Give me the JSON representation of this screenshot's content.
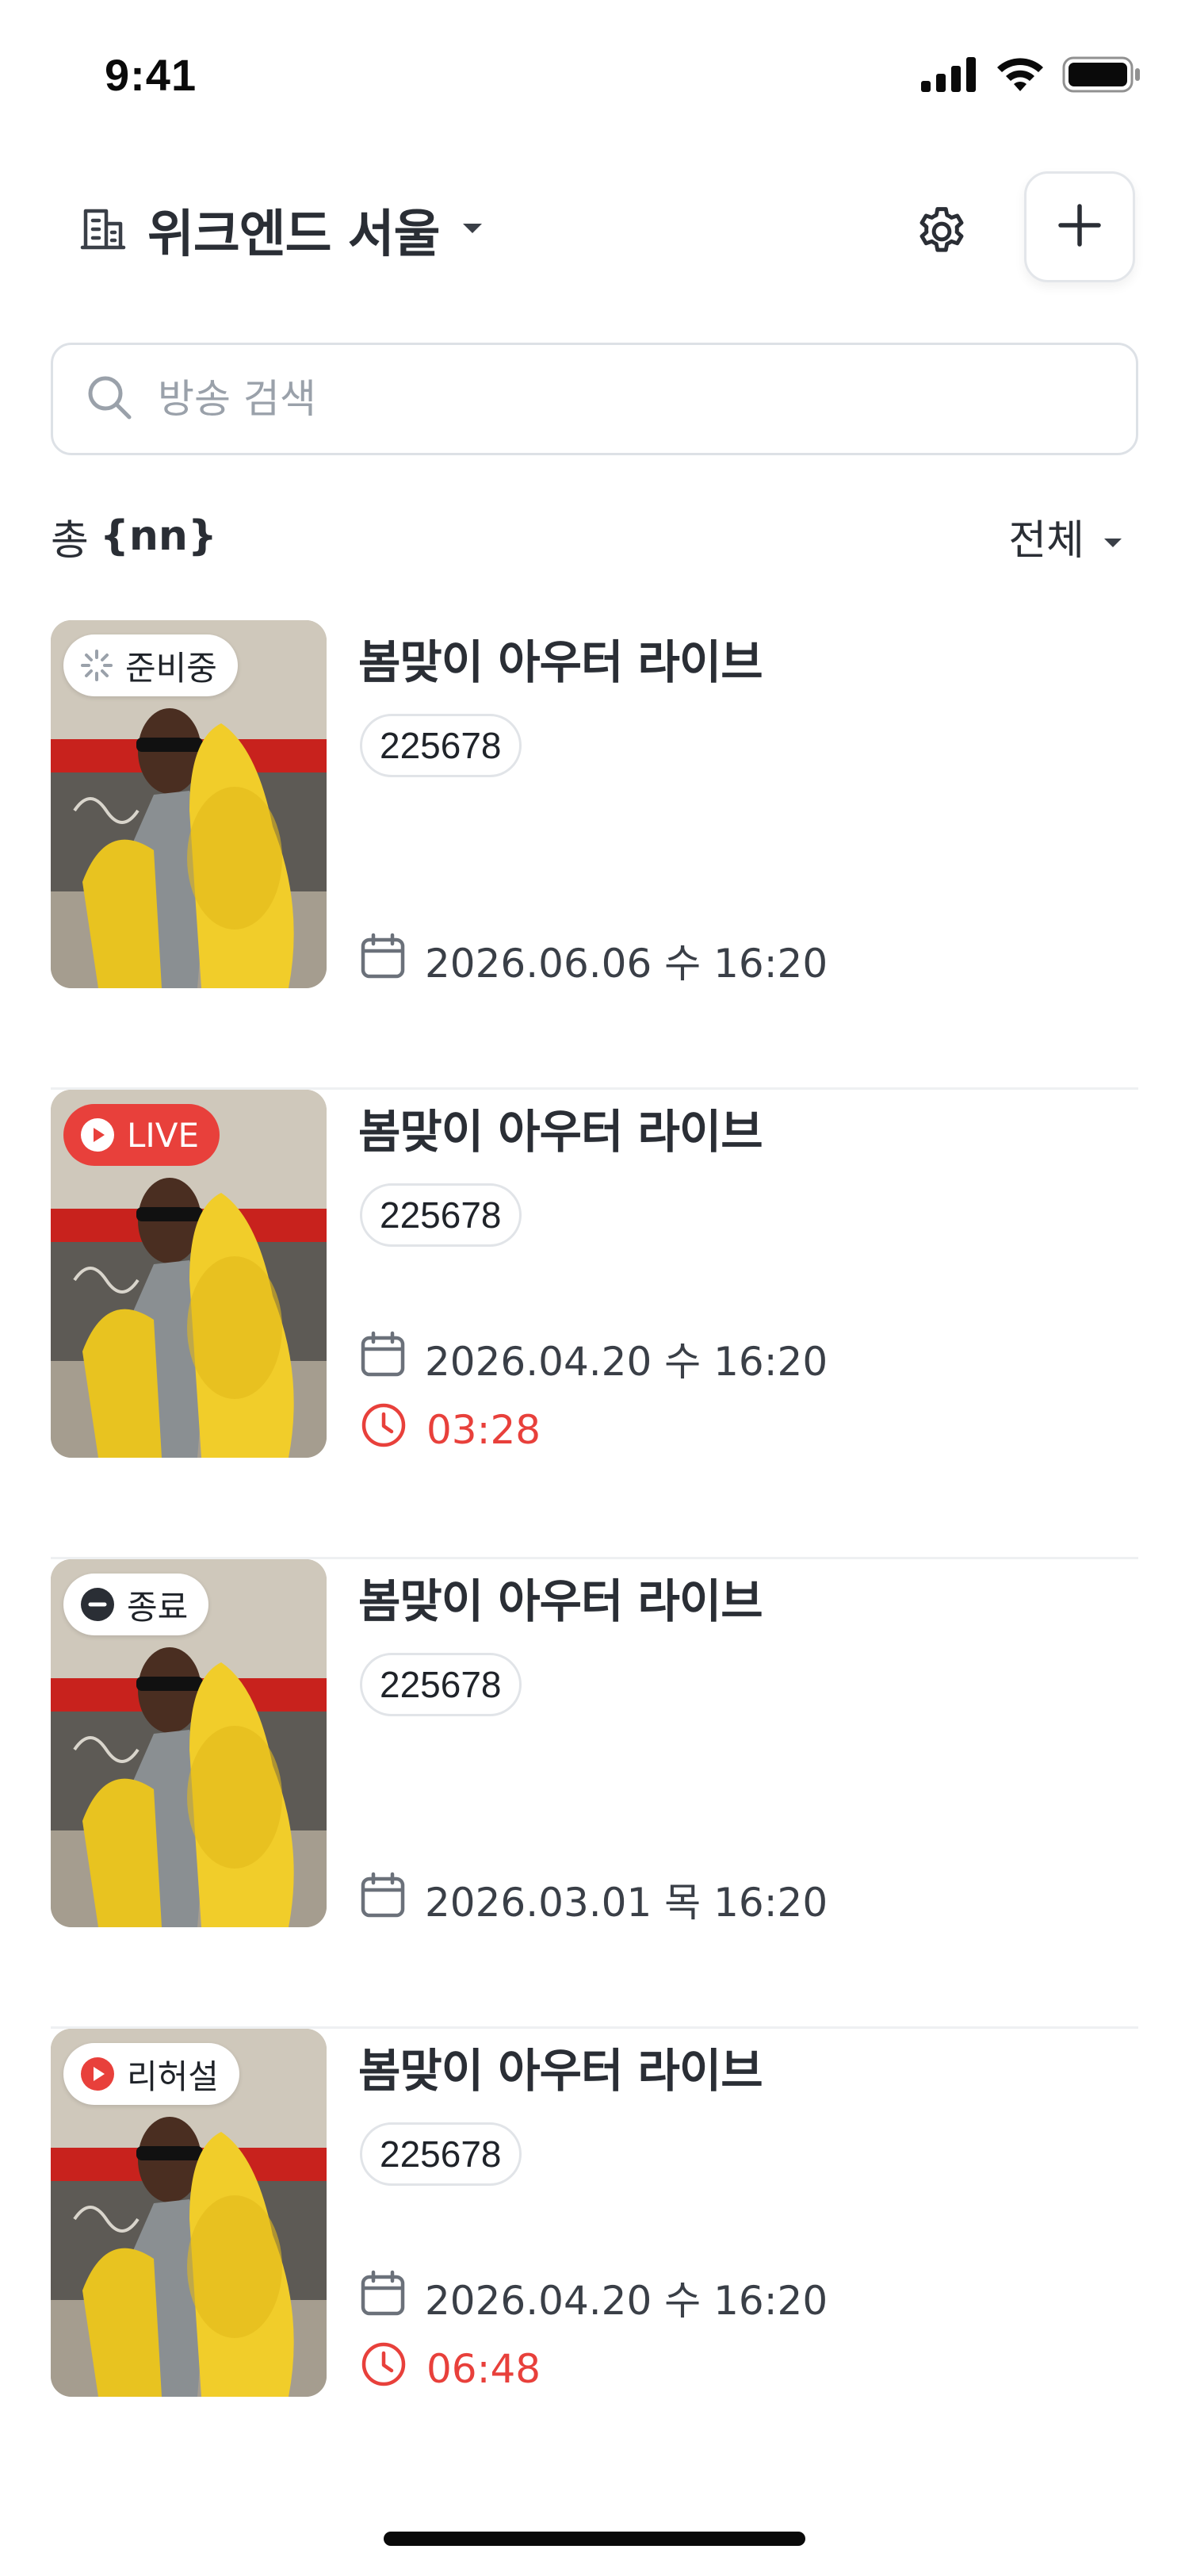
{
  "status_bar": {
    "time": "9:41",
    "icons": [
      "cellular-signal-icon",
      "wifi-icon",
      "battery-icon"
    ]
  },
  "header": {
    "store_icon": "building-icon",
    "store_name": "위크엔드 서울",
    "dropdown_icon": "caret-down-icon",
    "settings_icon": "gear-icon",
    "add_icon": "plus-icon"
  },
  "search": {
    "placeholder": "방송 검색",
    "value": "",
    "icon": "search-icon"
  },
  "summary": {
    "count_prefix": "총",
    "count_value": "{nn}",
    "filter_label": "전체"
  },
  "broadcasts": [
    {
      "status": "준비중",
      "status_icon": "loading-spinner-icon",
      "title": "봄맞이 아우터 라이브",
      "code": "225678",
      "date": "2026.06.06 수 16:20",
      "duration": ""
    },
    {
      "status": "LIVE",
      "status_icon": "play-circle-icon",
      "title": "봄맞이 아우터 라이브",
      "code": "225678",
      "date": "2026.04.20 수 16:20",
      "duration": "03:28"
    },
    {
      "status": "종료",
      "status_icon": "minus-circle-icon",
      "title": "봄맞이 아우터 라이브",
      "code": "225678",
      "date": "2026.03.01 목 16:20",
      "duration": ""
    },
    {
      "status": "리허설",
      "status_icon": "play-circle-icon",
      "title": "봄맞이 아우터 라이브",
      "code": "225678",
      "date": "2026.04.20 수 16:20",
      "duration": "06:48"
    }
  ],
  "colors": {
    "accent_live": "#e8403b",
    "text_primary": "#2a2e35",
    "text_placeholder": "#9aa1aa",
    "border": "#dde1e6"
  }
}
